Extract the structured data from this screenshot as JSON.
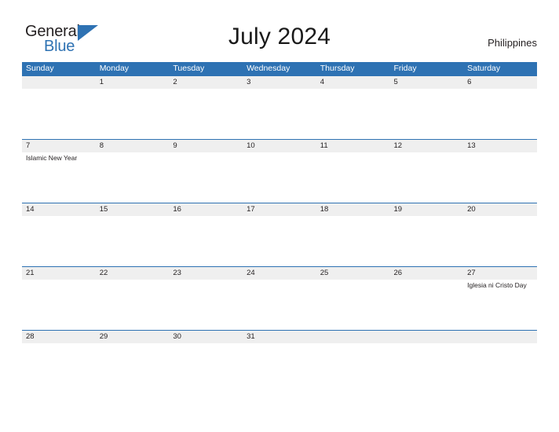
{
  "brand": {
    "name_part1": "General",
    "name_part2": "Blue",
    "accent_color": "#2e72b3",
    "text_color": "#231f20"
  },
  "header": {
    "title": "July 2024",
    "region": "Philippines"
  },
  "calendar": {
    "header_bg": "#2e72b3",
    "band_bg": "#efefef",
    "rule_color": "#2e72b3",
    "weekday_names": [
      "Sunday",
      "Monday",
      "Tuesday",
      "Wednesday",
      "Thursday",
      "Friday",
      "Saturday"
    ],
    "weeks": [
      {
        "days": [
          {
            "num": "",
            "events": []
          },
          {
            "num": "1",
            "events": []
          },
          {
            "num": "2",
            "events": []
          },
          {
            "num": "3",
            "events": []
          },
          {
            "num": "4",
            "events": []
          },
          {
            "num": "5",
            "events": []
          },
          {
            "num": "6",
            "events": []
          }
        ]
      },
      {
        "days": [
          {
            "num": "7",
            "events": [
              "Islamic New Year"
            ]
          },
          {
            "num": "8",
            "events": []
          },
          {
            "num": "9",
            "events": []
          },
          {
            "num": "10",
            "events": []
          },
          {
            "num": "11",
            "events": []
          },
          {
            "num": "12",
            "events": []
          },
          {
            "num": "13",
            "events": []
          }
        ]
      },
      {
        "days": [
          {
            "num": "14",
            "events": []
          },
          {
            "num": "15",
            "events": []
          },
          {
            "num": "16",
            "events": []
          },
          {
            "num": "17",
            "events": []
          },
          {
            "num": "18",
            "events": []
          },
          {
            "num": "19",
            "events": []
          },
          {
            "num": "20",
            "events": []
          }
        ]
      },
      {
        "days": [
          {
            "num": "21",
            "events": []
          },
          {
            "num": "22",
            "events": []
          },
          {
            "num": "23",
            "events": []
          },
          {
            "num": "24",
            "events": []
          },
          {
            "num": "25",
            "events": []
          },
          {
            "num": "26",
            "events": []
          },
          {
            "num": "27",
            "events": [
              "Iglesia ni Cristo Day"
            ]
          }
        ]
      },
      {
        "days": [
          {
            "num": "28",
            "events": []
          },
          {
            "num": "29",
            "events": []
          },
          {
            "num": "30",
            "events": []
          },
          {
            "num": "31",
            "events": []
          },
          {
            "num": "",
            "events": []
          },
          {
            "num": "",
            "events": []
          },
          {
            "num": "",
            "events": []
          }
        ]
      }
    ]
  }
}
